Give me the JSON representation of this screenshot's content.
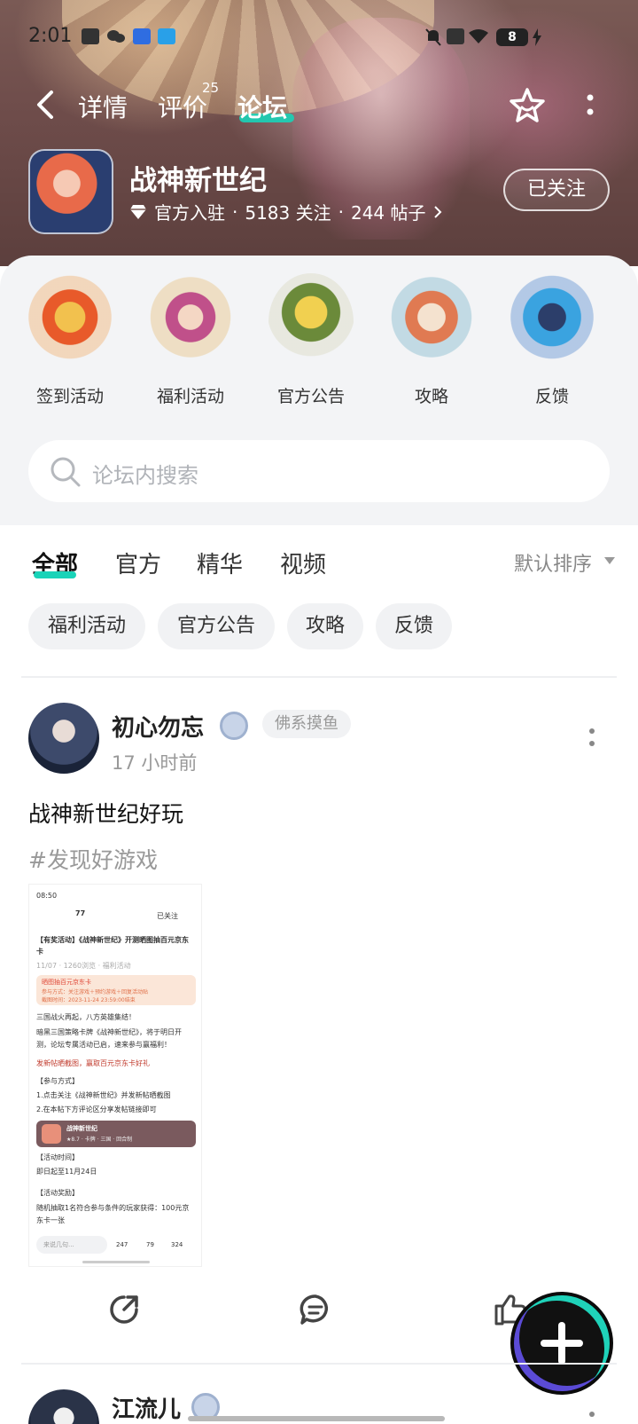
{
  "status_bar": {
    "time": "2:01",
    "battery": "8"
  },
  "nav": {
    "tabs": [
      {
        "label": "详情"
      },
      {
        "label": "评价",
        "count": "25"
      },
      {
        "label": "论坛"
      }
    ]
  },
  "game": {
    "name": "战神新世纪",
    "official": "官方入驻",
    "followers": "5183 关注",
    "posts": "244 帖子",
    "follow_button": "已关注"
  },
  "shortcuts": [
    {
      "label": "签到活动"
    },
    {
      "label": "福利活动"
    },
    {
      "label": "官方公告"
    },
    {
      "label": "攻略"
    },
    {
      "label": "反馈"
    }
  ],
  "search": {
    "placeholder": "论坛内搜索"
  },
  "filter_tabs": [
    {
      "label": "全部"
    },
    {
      "label": "官方"
    },
    {
      "label": "精华"
    },
    {
      "label": "视频"
    }
  ],
  "sort": {
    "label": "默认排序"
  },
  "chips": [
    {
      "label": "福利活动"
    },
    {
      "label": "官方公告"
    },
    {
      "label": "攻略"
    },
    {
      "label": "反馈"
    }
  ],
  "post": {
    "author": "初心勿忘",
    "author_tag": "佛系摸鱼",
    "time": "17 小时前",
    "title": "战神新世纪好玩",
    "hashtag": "#发现好游戏",
    "thumbnail": {
      "time": "08:50",
      "user": "77",
      "followed": "已关注",
      "headline": "【有奖活动】《战神新世纪》开测晒图抽百元京东卡",
      "meta": "11/07 · 1260浏览 · 福利活动",
      "banner_title": "晒图抽百元京东卡",
      "banner_line1": "参与方式：关注游戏＋预约游戏＋回复活动贴",
      "banner_line2": "截图时间：2023-11-24 23:59:00结束",
      "para1": "三国战火再起，八方英雄集结！",
      "para2": "暗黑三国策略卡牌《战神新世纪》，将于明日开测，论坛专属活动已启，速来参与赢福利！",
      "para3": "发新帖晒截图，赢取百元京东卡好礼",
      "section1": "【参与方式】",
      "step1": "1.点击关注《战神新世纪》并发新帖晒截图",
      "step2": "2.在本帖下方评论区分享发帖链接即可",
      "card_name": "战神新世纪",
      "card_meta": "★8.7 · 卡牌 · 三国 · 回合制",
      "section2": "【活动时间】",
      "duration": "即日起至11月24日",
      "section3": "【活动奖励】",
      "reward": "随机抽取1名符合参与条件的玩家获得：100元京东卡一张",
      "comment_ph": "来说几句...",
      "likes": "247",
      "favs": "79",
      "comments": "324"
    }
  },
  "next_post": {
    "author": "江流儿"
  },
  "colors": {
    "accent": "#19d3b8",
    "highlight": "#e04a3a"
  }
}
